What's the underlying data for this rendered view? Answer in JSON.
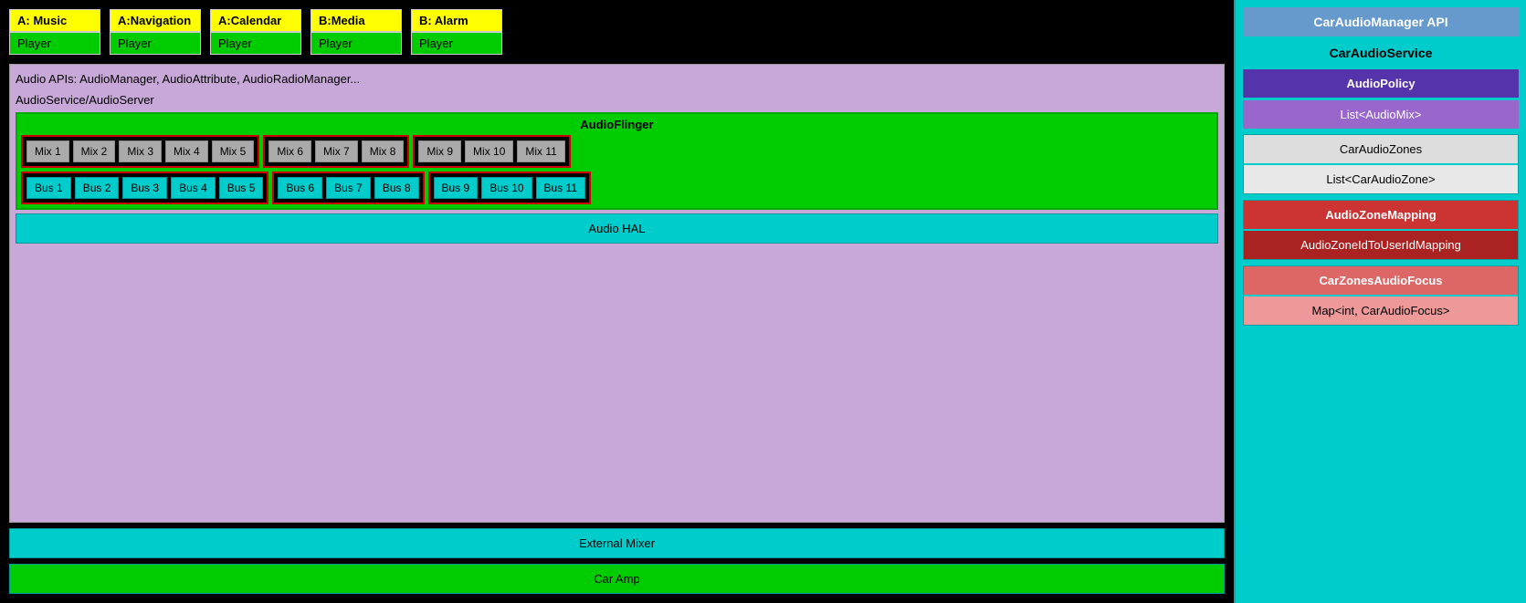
{
  "players": [
    {
      "label": "A: Music",
      "bottom": "Player"
    },
    {
      "label": "A:Navigation",
      "bottom": "Player"
    },
    {
      "label": "A:Calendar",
      "bottom": "Player"
    },
    {
      "label": "B:Media",
      "bottom": "Player"
    },
    {
      "label": "B: Alarm",
      "bottom": "Player"
    }
  ],
  "layers": {
    "audio_apis": "Audio APIs: AudioManager, AudioAttribute, AudioRadioManager...",
    "audio_service": "AudioService/AudioServer",
    "audio_flinger": "AudioFlinger"
  },
  "mix_groups": [
    {
      "mixes": [
        "Mix 1",
        "Mix 2",
        "Mix 3",
        "Mix 4",
        "Mix 5"
      ]
    },
    {
      "mixes": [
        "Mix 6",
        "Mix 7",
        "Mix 8"
      ]
    },
    {
      "mixes": [
        "Mix 9",
        "Mix 10",
        "Mix 11"
      ]
    }
  ],
  "bus_groups": [
    {
      "buses": [
        "Bus 1",
        "Bus 2",
        "Bus 3",
        "Bus 4",
        "Bus 5"
      ]
    },
    {
      "buses": [
        "Bus 6",
        "Bus 7",
        "Bus 8"
      ]
    },
    {
      "buses": [
        "Bus 9",
        "Bus 10",
        "Bus 11"
      ]
    }
  ],
  "audio_hal": "Audio HAL",
  "external_mixer": "External Mixer",
  "car_amp": "Car Amp",
  "right_panel": {
    "car_audio_manager_api": "CarAudioManager API",
    "car_audio_service": "CarAudioService",
    "audio_policy": "AudioPolicy",
    "list_audio_mix": "List<AudioMix>",
    "car_audio_zones": "CarAudioZones",
    "list_car_audio_zone": "List<CarAudioZone>",
    "audio_zone_mapping": "AudioZoneMapping",
    "audio_zone_id_to_user_id": "AudioZoneIdToUserIdMapping",
    "car_zones_audio_focus": "CarZonesAudioFocus",
    "map_car_audio_focus": "Map<int, CarAudioFocus>"
  }
}
